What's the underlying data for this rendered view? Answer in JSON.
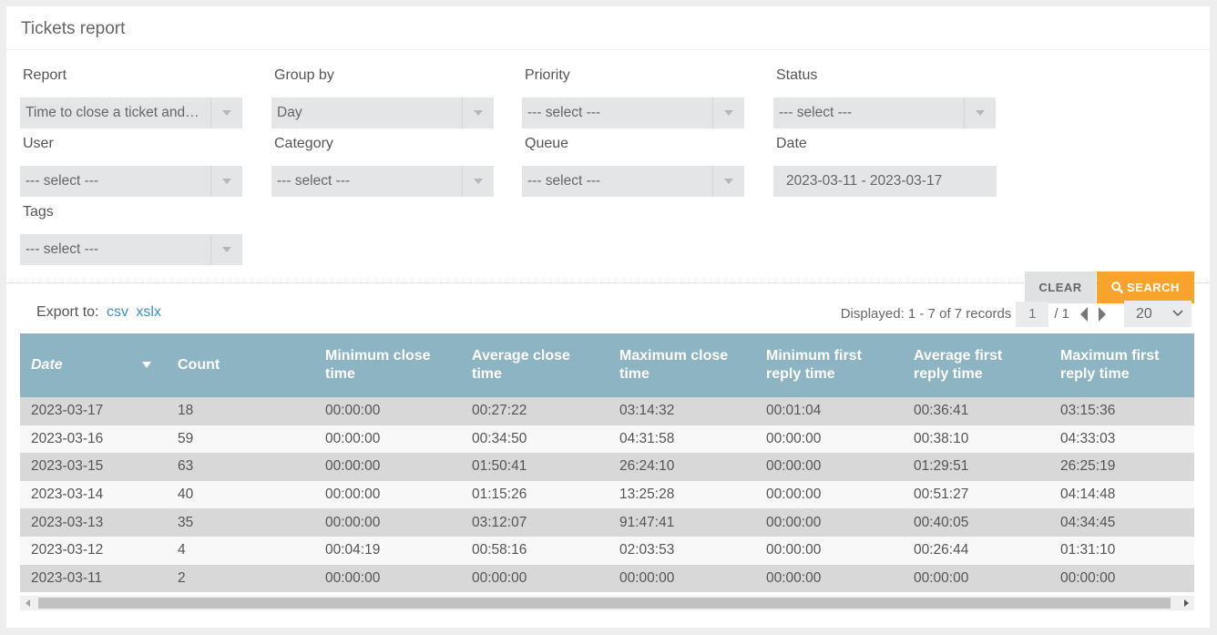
{
  "panel": {
    "title": "Tickets report"
  },
  "filters": {
    "report": {
      "label": "Report",
      "value": "Time to close a ticket and first reply time"
    },
    "group_by": {
      "label": "Group by",
      "value": "Day"
    },
    "priority": {
      "label": "Priority",
      "value": "--- select ---"
    },
    "status": {
      "label": "Status",
      "value": "--- select ---"
    },
    "user": {
      "label": "User",
      "value": "--- select ---"
    },
    "category": {
      "label": "Category",
      "value": "--- select ---"
    },
    "queue": {
      "label": "Queue",
      "value": "--- select ---"
    },
    "date": {
      "label": "Date",
      "value": "2023-03-11 - 2023-03-17"
    },
    "tags": {
      "label": "Tags",
      "value": "--- select ---"
    }
  },
  "buttons": {
    "clear": "CLEAR",
    "search": "SEARCH"
  },
  "export": {
    "label": "Export to:",
    "csv": "csv",
    "xlsx": "xslx"
  },
  "pager": {
    "displayed": "Displayed: 1 - 7 of 7 records",
    "page": "1",
    "total": "/ 1",
    "per_page": "20"
  },
  "table": {
    "columns": [
      "Date",
      "Count",
      "Minimum close time",
      "Average close time",
      "Maximum close time",
      "Minimum first reply time",
      "Average first reply time",
      "Maximum first reply time"
    ],
    "rows": [
      [
        "2023-03-17",
        "18",
        "00:00:00",
        "00:27:22",
        "03:14:32",
        "00:01:04",
        "00:36:41",
        "03:15:36"
      ],
      [
        "2023-03-16",
        "59",
        "00:00:00",
        "00:34:50",
        "04:31:58",
        "00:00:00",
        "00:38:10",
        "04:33:03"
      ],
      [
        "2023-03-15",
        "63",
        "00:00:00",
        "01:50:41",
        "26:24:10",
        "00:00:00",
        "01:29:51",
        "26:25:19"
      ],
      [
        "2023-03-14",
        "40",
        "00:00:00",
        "01:15:26",
        "13:25:28",
        "00:00:00",
        "00:51:27",
        "04:14:48"
      ],
      [
        "2023-03-13",
        "35",
        "00:00:00",
        "03:12:07",
        "91:47:41",
        "00:00:00",
        "00:40:05",
        "04:34:45"
      ],
      [
        "2023-03-12",
        "4",
        "00:04:19",
        "00:58:16",
        "02:03:53",
        "00:00:00",
        "00:26:44",
        "01:31:10"
      ],
      [
        "2023-03-11",
        "2",
        "00:00:00",
        "00:00:00",
        "00:00:00",
        "00:00:00",
        "00:00:00",
        "00:00:00"
      ]
    ]
  },
  "colors": {
    "header": "#8cb4c3",
    "accent": "#f8a42c",
    "link": "#3a8fc7"
  },
  "icons": {
    "search": "search-icon",
    "prev": "caret-left-icon",
    "next": "caret-right-icon"
  }
}
